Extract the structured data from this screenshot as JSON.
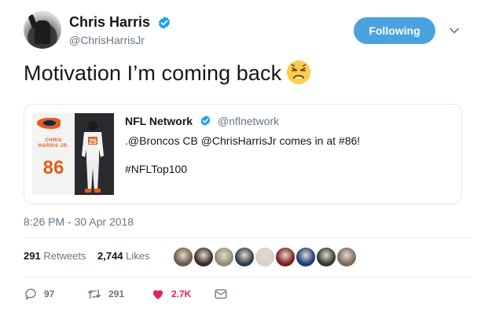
{
  "author": {
    "display_name": "Chris Harris",
    "handle": "@ChrisHarrisJr",
    "verified": true
  },
  "follow_button": {
    "label": "Following",
    "color": "#4aa3df"
  },
  "tweet": {
    "text": "Motivation I’m coming back",
    "emoji": "persevering-face-emoji"
  },
  "quoted_tweet": {
    "display_name": "NFL Network",
    "handle": "@nflnetwork",
    "verified": true,
    "text": ".@Broncos CB @ChrisHarrisJr comes in at #86!",
    "hashtag": "#NFLTop100",
    "image": {
      "player_name_lines": "CHRIS HARRIS JR.",
      "rank_number": "86",
      "jersey": "25"
    }
  },
  "timestamp": "8:26 PM - 30 Apr 2018",
  "stats": {
    "retweets_count": "291",
    "retweets_label": "Retweets",
    "likes_count": "2,744",
    "likes_label": "Likes"
  },
  "liker_colors": [
    "#6b5a4a",
    "#3a2d2a",
    "#8a8f7a",
    "#2c3e50",
    "#d8d0c8",
    "#7a1f1f",
    "#1d3b7a",
    "#2e3a2e",
    "#7a6a5a"
  ],
  "actions": {
    "reply_count": "97",
    "retweet_count": "291",
    "like_count": "2.7K"
  },
  "colors": {
    "text": "#14171a",
    "secondary": "#657786",
    "like": "#e0245e",
    "verified": "#1da1f2"
  }
}
